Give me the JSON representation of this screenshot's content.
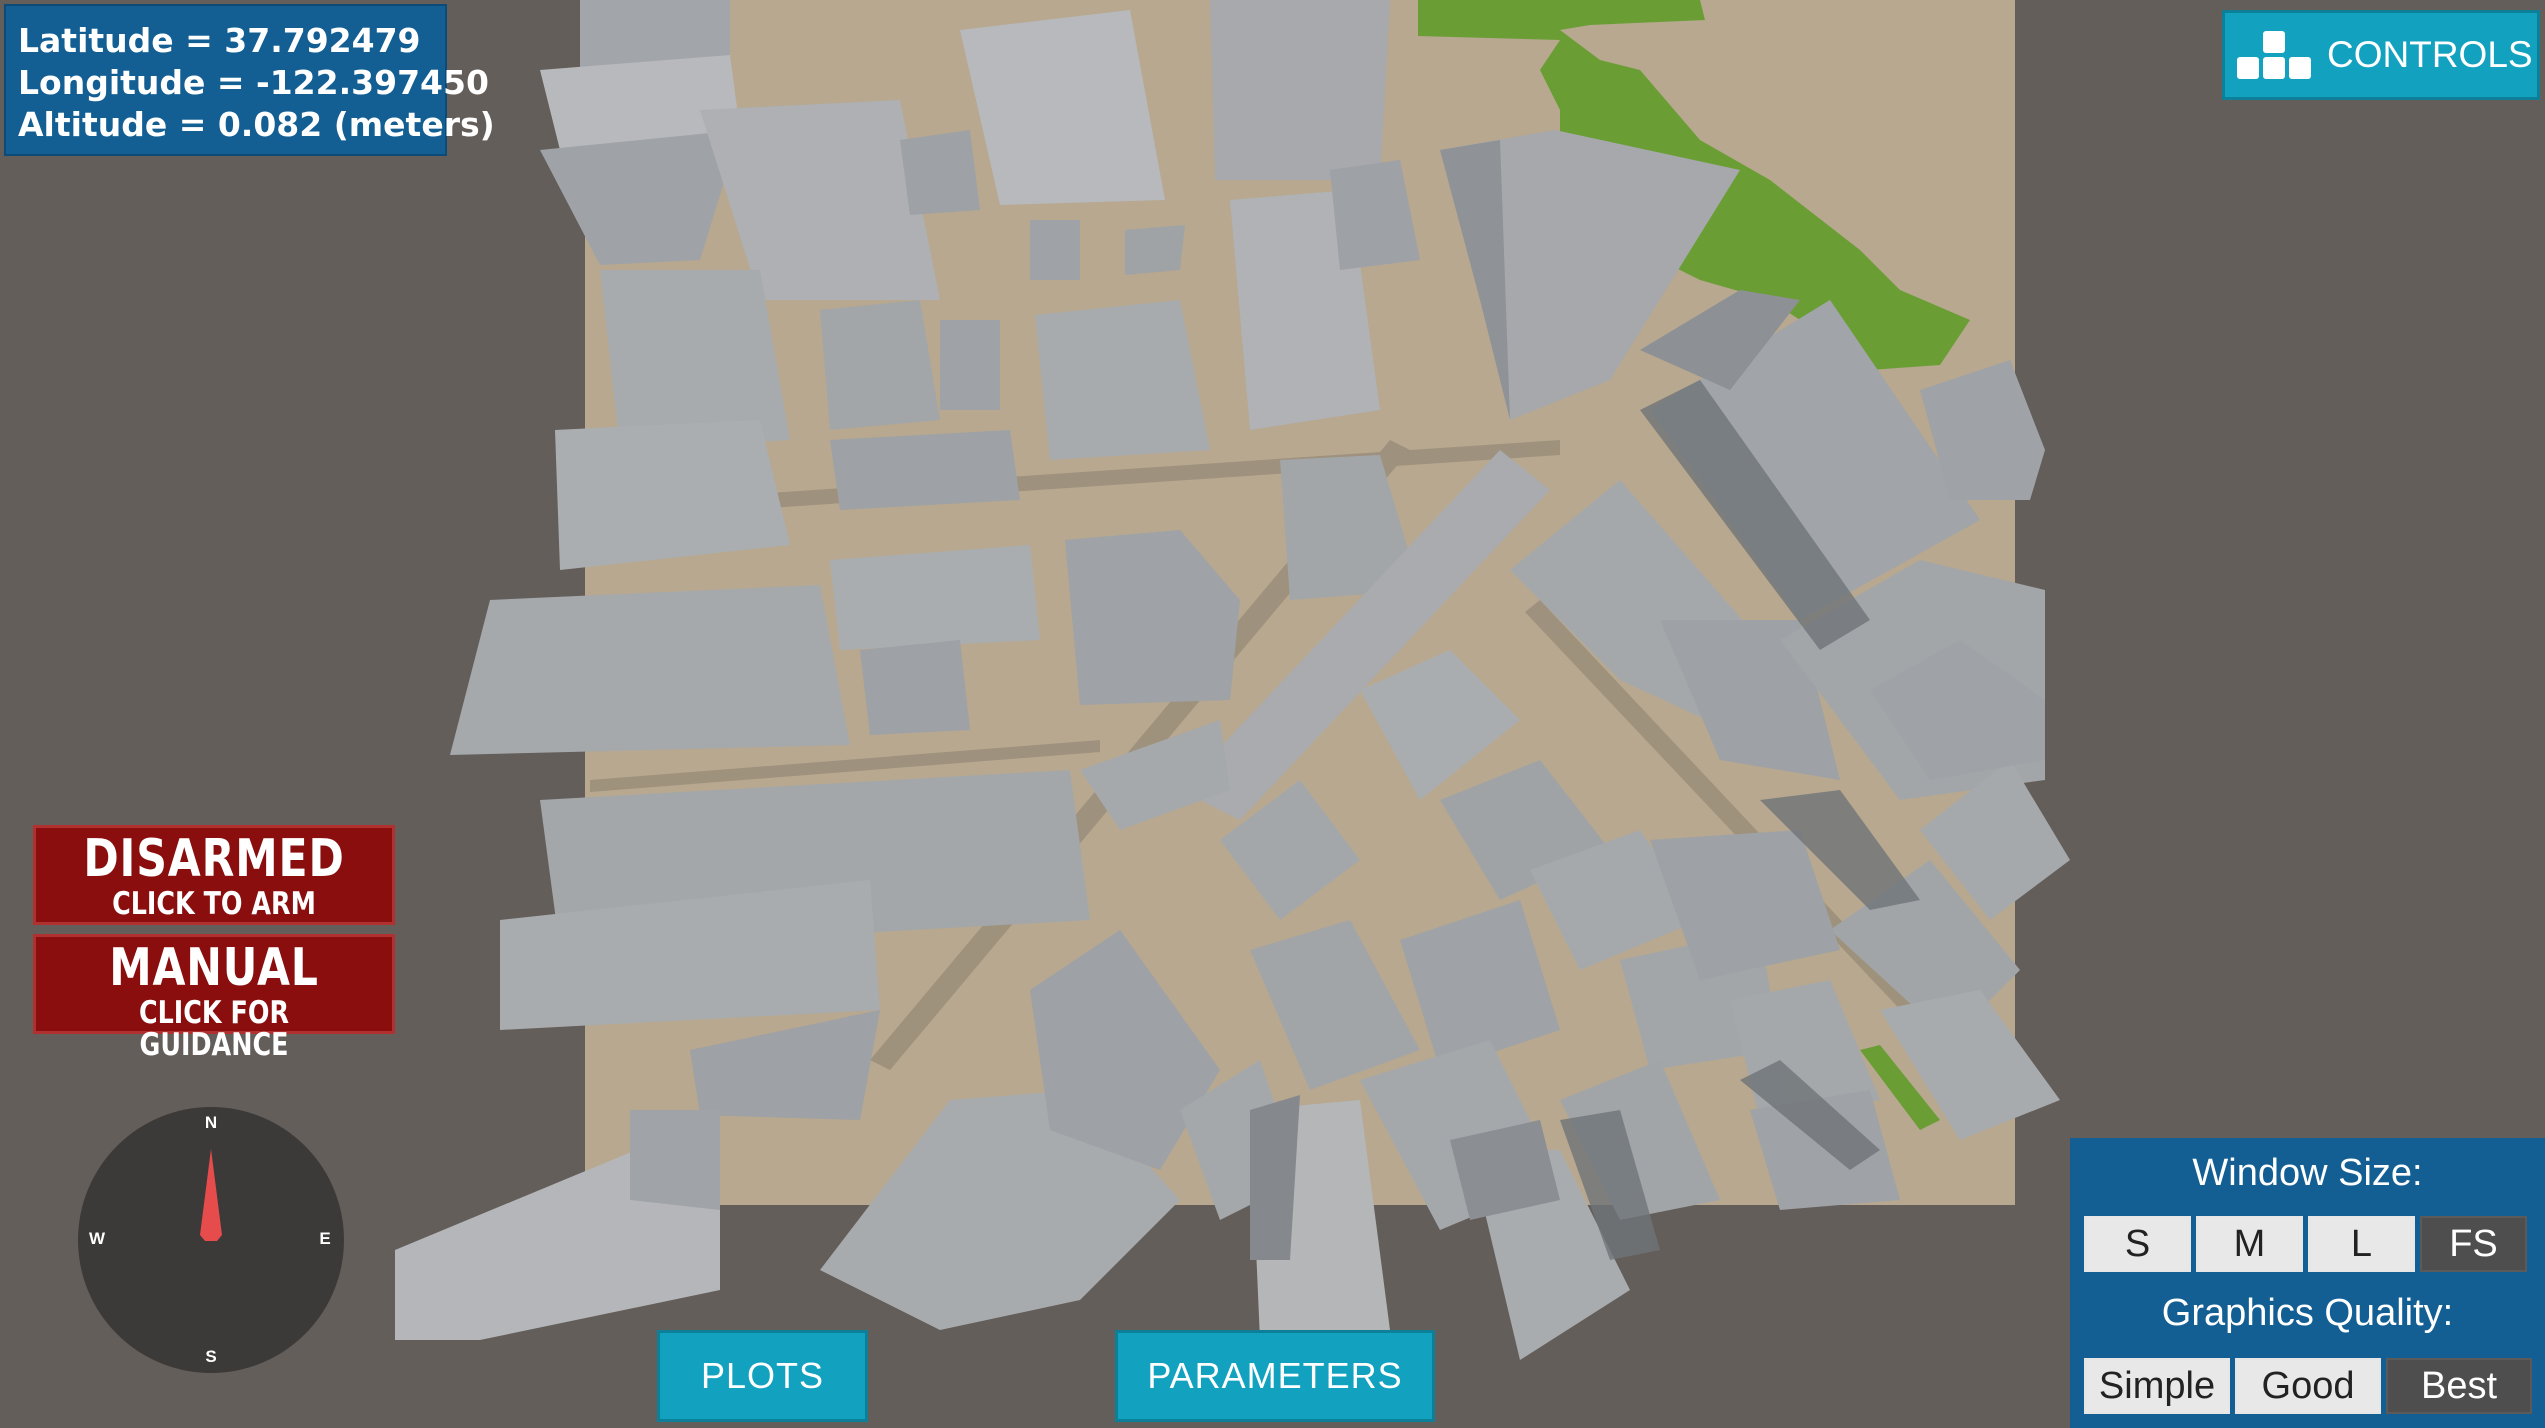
{
  "telemetry": {
    "latitude": "Latitude = 37.792479",
    "longitude": "Longitude = -122.397450",
    "altitude": "Altitude = 0.082 (meters)"
  },
  "controls_button": {
    "label": "CONTROLS"
  },
  "arm_button": {
    "title": "DISARMED",
    "subtitle": "CLICK TO ARM"
  },
  "mode_button": {
    "title": "MANUAL",
    "subtitle": "CLICK FOR GUIDANCE"
  },
  "compass": {
    "north": "N",
    "south": "S",
    "east": "E",
    "west": "W",
    "needle_color": "#e74c4c"
  },
  "bottom_buttons": {
    "plots": "PLOTS",
    "parameters": "PARAMETERS"
  },
  "window_panel": {
    "window_size_title": "Window Size:",
    "sizes": [
      "S",
      "M",
      "L",
      "FS"
    ],
    "graphics_title": "Graphics Quality:",
    "qualities": [
      "Simple",
      "Good",
      "Best"
    ]
  },
  "colors": {
    "panel_blue": "#135f93",
    "button_cyan": "#13a1c0",
    "button_red": "#8a0e0e",
    "ground": "#b7a88f",
    "building": "#a4a6aa",
    "park": "#6a9e35"
  }
}
